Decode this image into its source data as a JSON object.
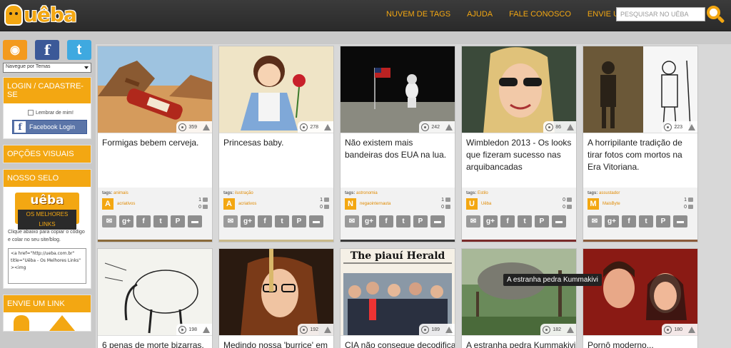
{
  "site": {
    "logo_text": "uêba"
  },
  "topnav": [
    "NUVEM DE TAGS",
    "AJUDA",
    "FALE CONOSCO",
    "ENVIE UM LINK"
  ],
  "search": {
    "placeholder": "PESQUISAR NO UÊBA"
  },
  "sidebar": {
    "social": [
      "rss-icon",
      "facebook-icon",
      "twitter-icon"
    ],
    "navigate_select": "Navegue por Temas",
    "login": {
      "title": "LOGIN / CADASTRE-SE",
      "remember": "Lembrar de mim!",
      "fb_button": "Facebook Login"
    },
    "visual": {
      "title": "OPÇÕES VISUAIS"
    },
    "selo": {
      "title": "NOSSO SELO",
      "badge_top": "uêba",
      "badge_bottom": "OS MELHORES LINKS",
      "text": "Clique abaixo para copiar o código e colar no seu site/blog.",
      "code": "<a href=\"http://ueba.com.br\" title=\"Uêba - Os Melhores Links\" ><img"
    },
    "envie": {
      "title": "ENVIE UM LINK"
    }
  },
  "cards": [
    {
      "title": "Formigas bebem cerveja.",
      "views": "359",
      "tags_label": "tags:",
      "tag": "animais",
      "avatar": "A",
      "author": "acriativos",
      "stat1": "1",
      "stat2": "0",
      "line_color": "#8a6a3a"
    },
    {
      "title": "Princesas baby.",
      "views": "278",
      "tags_label": "tags:",
      "tag": "ilustração",
      "avatar": "A",
      "author": "acriativos",
      "stat1": "1",
      "stat2": "0",
      "line_color": "#c9b98a"
    },
    {
      "title": "Não existem mais bandeiras dos EUA na lua.",
      "views": "242",
      "tags_label": "tags:",
      "tag": "astronomia",
      "avatar": "N",
      "author": "negaointernauta",
      "stat1": "1",
      "stat2": "0",
      "line_color": "#3a3a3a"
    },
    {
      "title": "Wimbledon 2013 - Os looks que fizeram sucesso nas arquibancadas",
      "views": "86",
      "tags_label": "tags:",
      "tag": "Estilo",
      "avatar": "U",
      "author": "Uêba",
      "stat1": "0",
      "stat2": "0",
      "line_color": "#7a2a2a"
    },
    {
      "title": "A horripilante tradição de tirar fotos com mortos na Era Vitoriana.",
      "views": "223",
      "tags_label": "tags:",
      "tag": "assustador",
      "avatar": "M",
      "author": "MaisByte",
      "stat1": "1",
      "stat2": "0",
      "line_color": "#8a5a3a"
    },
    {
      "title": "6 penas de morte bizarras.",
      "views": "198"
    },
    {
      "title": "Medindo nossa 'burrice' em",
      "views": "192"
    },
    {
      "title": "CIA não consegue decodificar",
      "views": "189",
      "newspaper": "The piauí Herald"
    },
    {
      "title": "A estranha pedra Kummakivi",
      "views": "182"
    },
    {
      "title": "Pornô moderno...",
      "views": "180"
    }
  ],
  "tooltip": "A estranha pedra Kummakivi",
  "share_icons": [
    "email-icon",
    "google-plus-icon",
    "facebook-icon",
    "twitter-icon",
    "pinterest-icon",
    "comment-icon"
  ],
  "share_labels": {
    "gplus": "g+",
    "fb": "f",
    "tw": "t",
    "pin": "P"
  }
}
